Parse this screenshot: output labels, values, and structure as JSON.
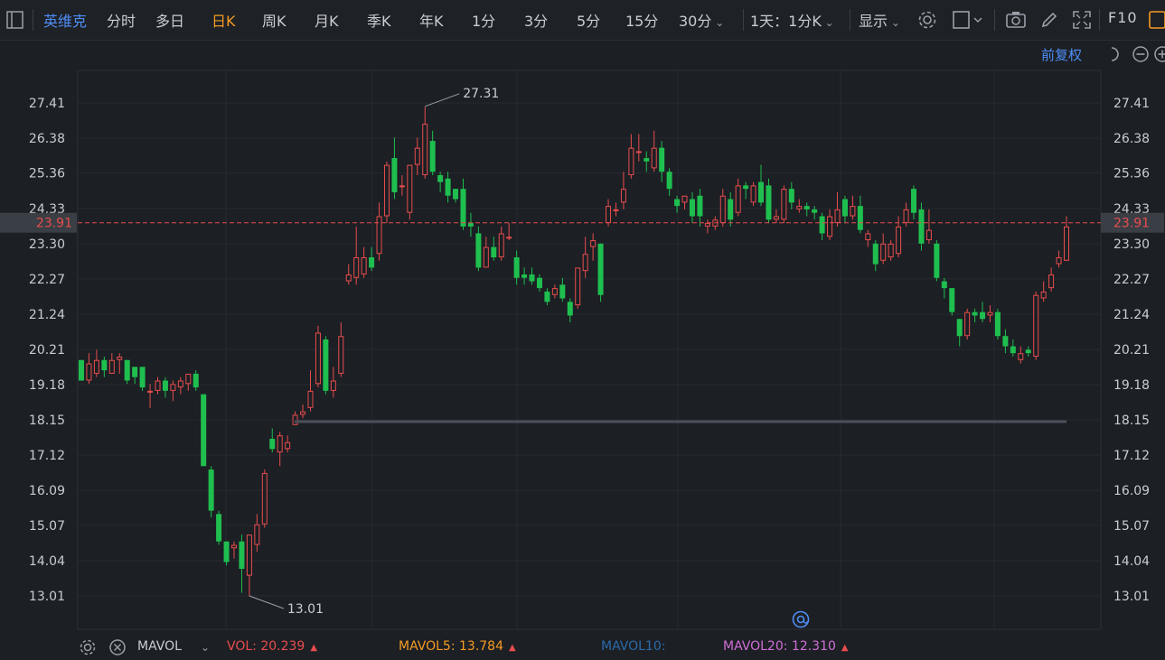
{
  "toolbar": {
    "stock_name": "英维克",
    "tabs": [
      "分时",
      "多日",
      "日K",
      "周K",
      "月K",
      "季K",
      "年K",
      "1分",
      "3分",
      "5分",
      "15分",
      "30分"
    ],
    "active_tab": "日K",
    "period_select": "1天：1分K",
    "display_label": "显示",
    "f10_label": "F10",
    "adjust_label": "前复权"
  },
  "colors": {
    "background": "#1c1f24",
    "up": "#e84d4d",
    "down": "#1fbf4f",
    "price_line": "#e84d4d",
    "mavol5": "#f59a23",
    "mavol10": "#2b6aa8",
    "mavol20": "#d06fd6",
    "accent_blue": "#4f8ef7"
  },
  "chart_data": {
    "type": "candlestick",
    "y_ticks": [
      "27.41",
      "26.38",
      "25.36",
      "24.33",
      "23.30",
      "22.27",
      "21.24",
      "20.21",
      "19.18",
      "18.15",
      "17.12",
      "16.09",
      "15.07",
      "14.04",
      "13.01"
    ],
    "ylim": [
      13.01,
      27.41
    ],
    "current_price": 23.91,
    "current_price_label": "23.91",
    "high_label": "27.31",
    "low_label": "13.01",
    "high_value": 27.31,
    "low_value": 13.01,
    "support_line": 18.1,
    "candles": [
      [
        19.9,
        19.3,
        19.9,
        19.3
      ],
      [
        19.3,
        19.8,
        20.1,
        19.2
      ],
      [
        19.5,
        19.9,
        20.2,
        19.4
      ],
      [
        19.9,
        19.6,
        20.0,
        19.4
      ],
      [
        19.5,
        19.9,
        20.1,
        19.5
      ],
      [
        19.9,
        20.0,
        20.1,
        19.5
      ],
      [
        19.9,
        19.3,
        19.9,
        19.2
      ],
      [
        19.7,
        19.4,
        19.7,
        19.2
      ],
      [
        19.7,
        19.1,
        19.7,
        19.0
      ],
      [
        19.0,
        19.0,
        19.2,
        18.5
      ],
      [
        19.0,
        19.3,
        19.4,
        18.9
      ],
      [
        19.3,
        19.0,
        19.4,
        18.8
      ],
      [
        19.0,
        19.2,
        19.3,
        18.7
      ],
      [
        19.1,
        19.3,
        19.4,
        18.9
      ],
      [
        19.2,
        19.5,
        19.5,
        19.0
      ],
      [
        19.5,
        19.1,
        19.6,
        19.0
      ],
      [
        18.9,
        16.8,
        18.9,
        16.8
      ],
      [
        16.7,
        15.5,
        16.8,
        15.3
      ],
      [
        15.4,
        14.6,
        15.5,
        14.5
      ],
      [
        14.6,
        14.0,
        14.6,
        13.9
      ],
      [
        14.4,
        14.5,
        14.6,
        14.1
      ],
      [
        14.6,
        13.8,
        14.8,
        13.1
      ],
      [
        13.6,
        14.8,
        14.8,
        13.0
      ],
      [
        14.5,
        15.1,
        15.4,
        14.3
      ],
      [
        15.1,
        16.6,
        16.7,
        15.0
      ],
      [
        17.6,
        17.3,
        17.9,
        17.2
      ],
      [
        17.2,
        17.7,
        17.8,
        16.8
      ],
      [
        17.3,
        17.5,
        17.7,
        17.2
      ],
      [
        18.0,
        18.3,
        18.4,
        18.0
      ],
      [
        18.3,
        18.4,
        18.6,
        18.2
      ],
      [
        18.5,
        19.0,
        19.6,
        18.4
      ],
      [
        19.2,
        20.7,
        20.9,
        19.1
      ],
      [
        20.5,
        19.0,
        20.6,
        18.9
      ],
      [
        19.0,
        19.3,
        19.7,
        18.8
      ],
      [
        19.5,
        20.6,
        21.0,
        19.4
      ],
      [
        22.2,
        22.4,
        22.7,
        22.1
      ],
      [
        22.3,
        22.9,
        23.8,
        22.1
      ],
      [
        22.4,
        22.9,
        23.2,
        22.3
      ],
      [
        22.9,
        22.6,
        23.2,
        22.5
      ],
      [
        23.0,
        24.1,
        24.5,
        22.8
      ],
      [
        24.1,
        25.6,
        25.7,
        23.9
      ],
      [
        25.8,
        24.8,
        26.4,
        24.6
      ],
      [
        25.0,
        25.0,
        25.3,
        24.7
      ],
      [
        24.2,
        25.6,
        25.6,
        24.0
      ],
      [
        25.6,
        26.1,
        26.4,
        25.3
      ],
      [
        25.3,
        26.8,
        27.3,
        25.2
      ],
      [
        26.3,
        25.4,
        26.6,
        25.3
      ],
      [
        25.3,
        25.1,
        25.4,
        24.8
      ],
      [
        25.2,
        24.7,
        25.4,
        24.5
      ],
      [
        24.9,
        24.6,
        24.9,
        24.5
      ],
      [
        24.9,
        23.8,
        25.2,
        23.7
      ],
      [
        23.9,
        23.8,
        24.2,
        23.5
      ],
      [
        23.6,
        22.6,
        23.8,
        22.5
      ],
      [
        22.6,
        23.2,
        23.5,
        22.6
      ],
      [
        23.2,
        22.9,
        23.5,
        22.8
      ],
      [
        22.9,
        23.6,
        23.8,
        22.8
      ],
      [
        23.5,
        23.5,
        23.9,
        23.4
      ],
      [
        22.9,
        22.3,
        23.1,
        22.1
      ],
      [
        22.4,
        22.3,
        22.6,
        22.1
      ],
      [
        22.4,
        22.2,
        22.6,
        22.1
      ],
      [
        22.3,
        22.0,
        22.4,
        21.9
      ],
      [
        21.9,
        21.6,
        22.0,
        21.5
      ],
      [
        21.8,
        22.0,
        22.1,
        21.7
      ],
      [
        22.1,
        21.7,
        22.3,
        21.6
      ],
      [
        21.6,
        21.2,
        21.7,
        21.0
      ],
      [
        21.5,
        22.6,
        22.6,
        21.4
      ],
      [
        22.5,
        23.0,
        23.5,
        22.3
      ],
      [
        23.2,
        23.4,
        23.6,
        22.8
      ],
      [
        23.3,
        21.8,
        23.3,
        21.6
      ],
      [
        23.9,
        24.4,
        24.6,
        23.8
      ],
      [
        24.3,
        24.3,
        24.5,
        24.1
      ],
      [
        24.5,
        24.9,
        25.4,
        24.3
      ],
      [
        25.3,
        26.1,
        26.5,
        25.2
      ],
      [
        26.0,
        26.0,
        26.5,
        25.7
      ],
      [
        25.8,
        25.7,
        26.0,
        25.4
      ],
      [
        25.5,
        26.1,
        26.6,
        25.4
      ],
      [
        26.1,
        25.4,
        26.3,
        25.1
      ],
      [
        25.4,
        24.9,
        25.5,
        24.7
      ],
      [
        24.6,
        24.4,
        24.7,
        24.2
      ],
      [
        24.5,
        24.7,
        24.7,
        24.3
      ],
      [
        24.6,
        24.1,
        24.8,
        23.9
      ],
      [
        24.7,
        24.1,
        24.9,
        23.8
      ],
      [
        23.8,
        23.9,
        24.0,
        23.6
      ],
      [
        23.8,
        24.0,
        24.1,
        23.7
      ],
      [
        23.9,
        24.7,
        24.9,
        23.8
      ],
      [
        24.6,
        24.0,
        24.8,
        23.8
      ],
      [
        24.2,
        25.0,
        25.2,
        24.1
      ],
      [
        25.0,
        24.9,
        25.1,
        24.6
      ],
      [
        24.5,
        25.0,
        25.1,
        24.4
      ],
      [
        25.1,
        24.5,
        25.6,
        24.4
      ],
      [
        25.0,
        24.0,
        25.2,
        23.9
      ],
      [
        24.0,
        24.1,
        24.3,
        23.9
      ],
      [
        24.0,
        24.9,
        25.0,
        23.9
      ],
      [
        24.9,
        24.5,
        25.1,
        24.3
      ],
      [
        24.3,
        24.4,
        24.6,
        24.2
      ],
      [
        24.4,
        24.3,
        24.5,
        24.1
      ],
      [
        24.3,
        24.2,
        24.4,
        24.0
      ],
      [
        24.1,
        23.6,
        24.2,
        23.4
      ],
      [
        23.5,
        24.1,
        24.3,
        23.4
      ],
      [
        23.9,
        24.3,
        24.8,
        23.8
      ],
      [
        24.6,
        24.1,
        24.7,
        23.9
      ],
      [
        24.1,
        24.4,
        24.7,
        24.0
      ],
      [
        24.4,
        23.7,
        24.7,
        23.6
      ],
      [
        23.4,
        23.6,
        23.7,
        23.2
      ],
      [
        23.3,
        22.7,
        23.4,
        22.5
      ],
      [
        22.8,
        23.3,
        23.6,
        22.7
      ],
      [
        22.9,
        23.3,
        23.4,
        22.8
      ],
      [
        23.0,
        23.8,
        24.1,
        22.9
      ],
      [
        23.9,
        24.3,
        24.5,
        23.8
      ],
      [
        24.9,
        24.2,
        25.0,
        24.0
      ],
      [
        24.3,
        23.3,
        24.5,
        23.1
      ],
      [
        23.4,
        23.7,
        24.3,
        23.3
      ],
      [
        23.3,
        22.3,
        23.4,
        22.2
      ],
      [
        22.2,
        22.0,
        22.3,
        21.7
      ],
      [
        22.0,
        21.3,
        22.0,
        21.2
      ],
      [
        21.1,
        20.6,
        21.1,
        20.3
      ],
      [
        20.6,
        21.3,
        21.4,
        20.5
      ],
      [
        21.3,
        21.2,
        21.4,
        21.0
      ],
      [
        21.3,
        21.1,
        21.6,
        21.0
      ],
      [
        21.2,
        21.3,
        21.5,
        21.0
      ],
      [
        21.3,
        20.6,
        21.4,
        20.5
      ],
      [
        20.6,
        20.3,
        20.8,
        20.1
      ],
      [
        20.3,
        20.1,
        20.5,
        20.0
      ],
      [
        19.9,
        20.1,
        20.3,
        19.8
      ],
      [
        20.2,
        20.1,
        20.3,
        20.0
      ],
      [
        20.0,
        21.8,
        21.9,
        19.9
      ],
      [
        21.7,
        21.9,
        22.2,
        21.6
      ],
      [
        22.0,
        22.4,
        22.6,
        21.9
      ],
      [
        22.7,
        22.9,
        23.1,
        22.6
      ],
      [
        22.8,
        23.8,
        24.1,
        22.8
      ]
    ]
  },
  "footer": {
    "indicator": "MAVOL",
    "vol_label": "VOL:",
    "vol_value": "20.239",
    "mavol5_label": "MAVOL5:",
    "mavol5_value": "13.784",
    "mavol10_label": "MAVOL10:",
    "mavol20_label": "MAVOL20:",
    "mavol20_value": "12.310"
  }
}
